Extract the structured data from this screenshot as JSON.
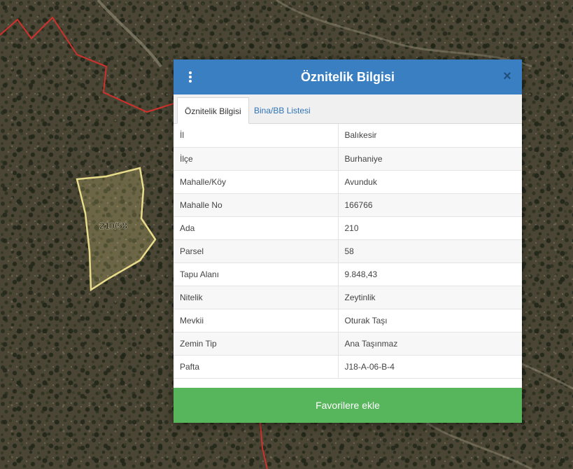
{
  "map": {
    "parcel_label": "210/58",
    "boundary_color": "#d1302c",
    "parcel_color": "#e8dc8a"
  },
  "dialog": {
    "title": "Öznitelik Bilgisi",
    "menu_icon": "vertical-dots-icon",
    "close_icon": "close-icon",
    "close_symbol": "×",
    "header_color": "#3a7fc1",
    "tabs": [
      {
        "label": "Öznitelik Bilgisi",
        "active": true
      },
      {
        "label": "Bina/BB Listesi",
        "active": false
      }
    ],
    "rows": [
      {
        "key": "İl",
        "value": "Balıkesir"
      },
      {
        "key": "İlçe",
        "value": "Burhaniye"
      },
      {
        "key": "Mahalle/Köy",
        "value": "Avunduk"
      },
      {
        "key": "Mahalle No",
        "value": "166766"
      },
      {
        "key": "Ada",
        "value": "210"
      },
      {
        "key": "Parsel",
        "value": "58"
      },
      {
        "key": "Tapu Alanı",
        "value": "9.848,43"
      },
      {
        "key": "Nitelik",
        "value": "Zeytinlik"
      },
      {
        "key": "Mevkii",
        "value": "Oturak Taşı"
      },
      {
        "key": "Zemin Tip",
        "value": "Ana Taşınmaz"
      },
      {
        "key": "Pafta",
        "value": "J18-A-06-B-4"
      }
    ],
    "favorite_button": "Favorilere ekle",
    "favorite_color": "#57b65c"
  }
}
